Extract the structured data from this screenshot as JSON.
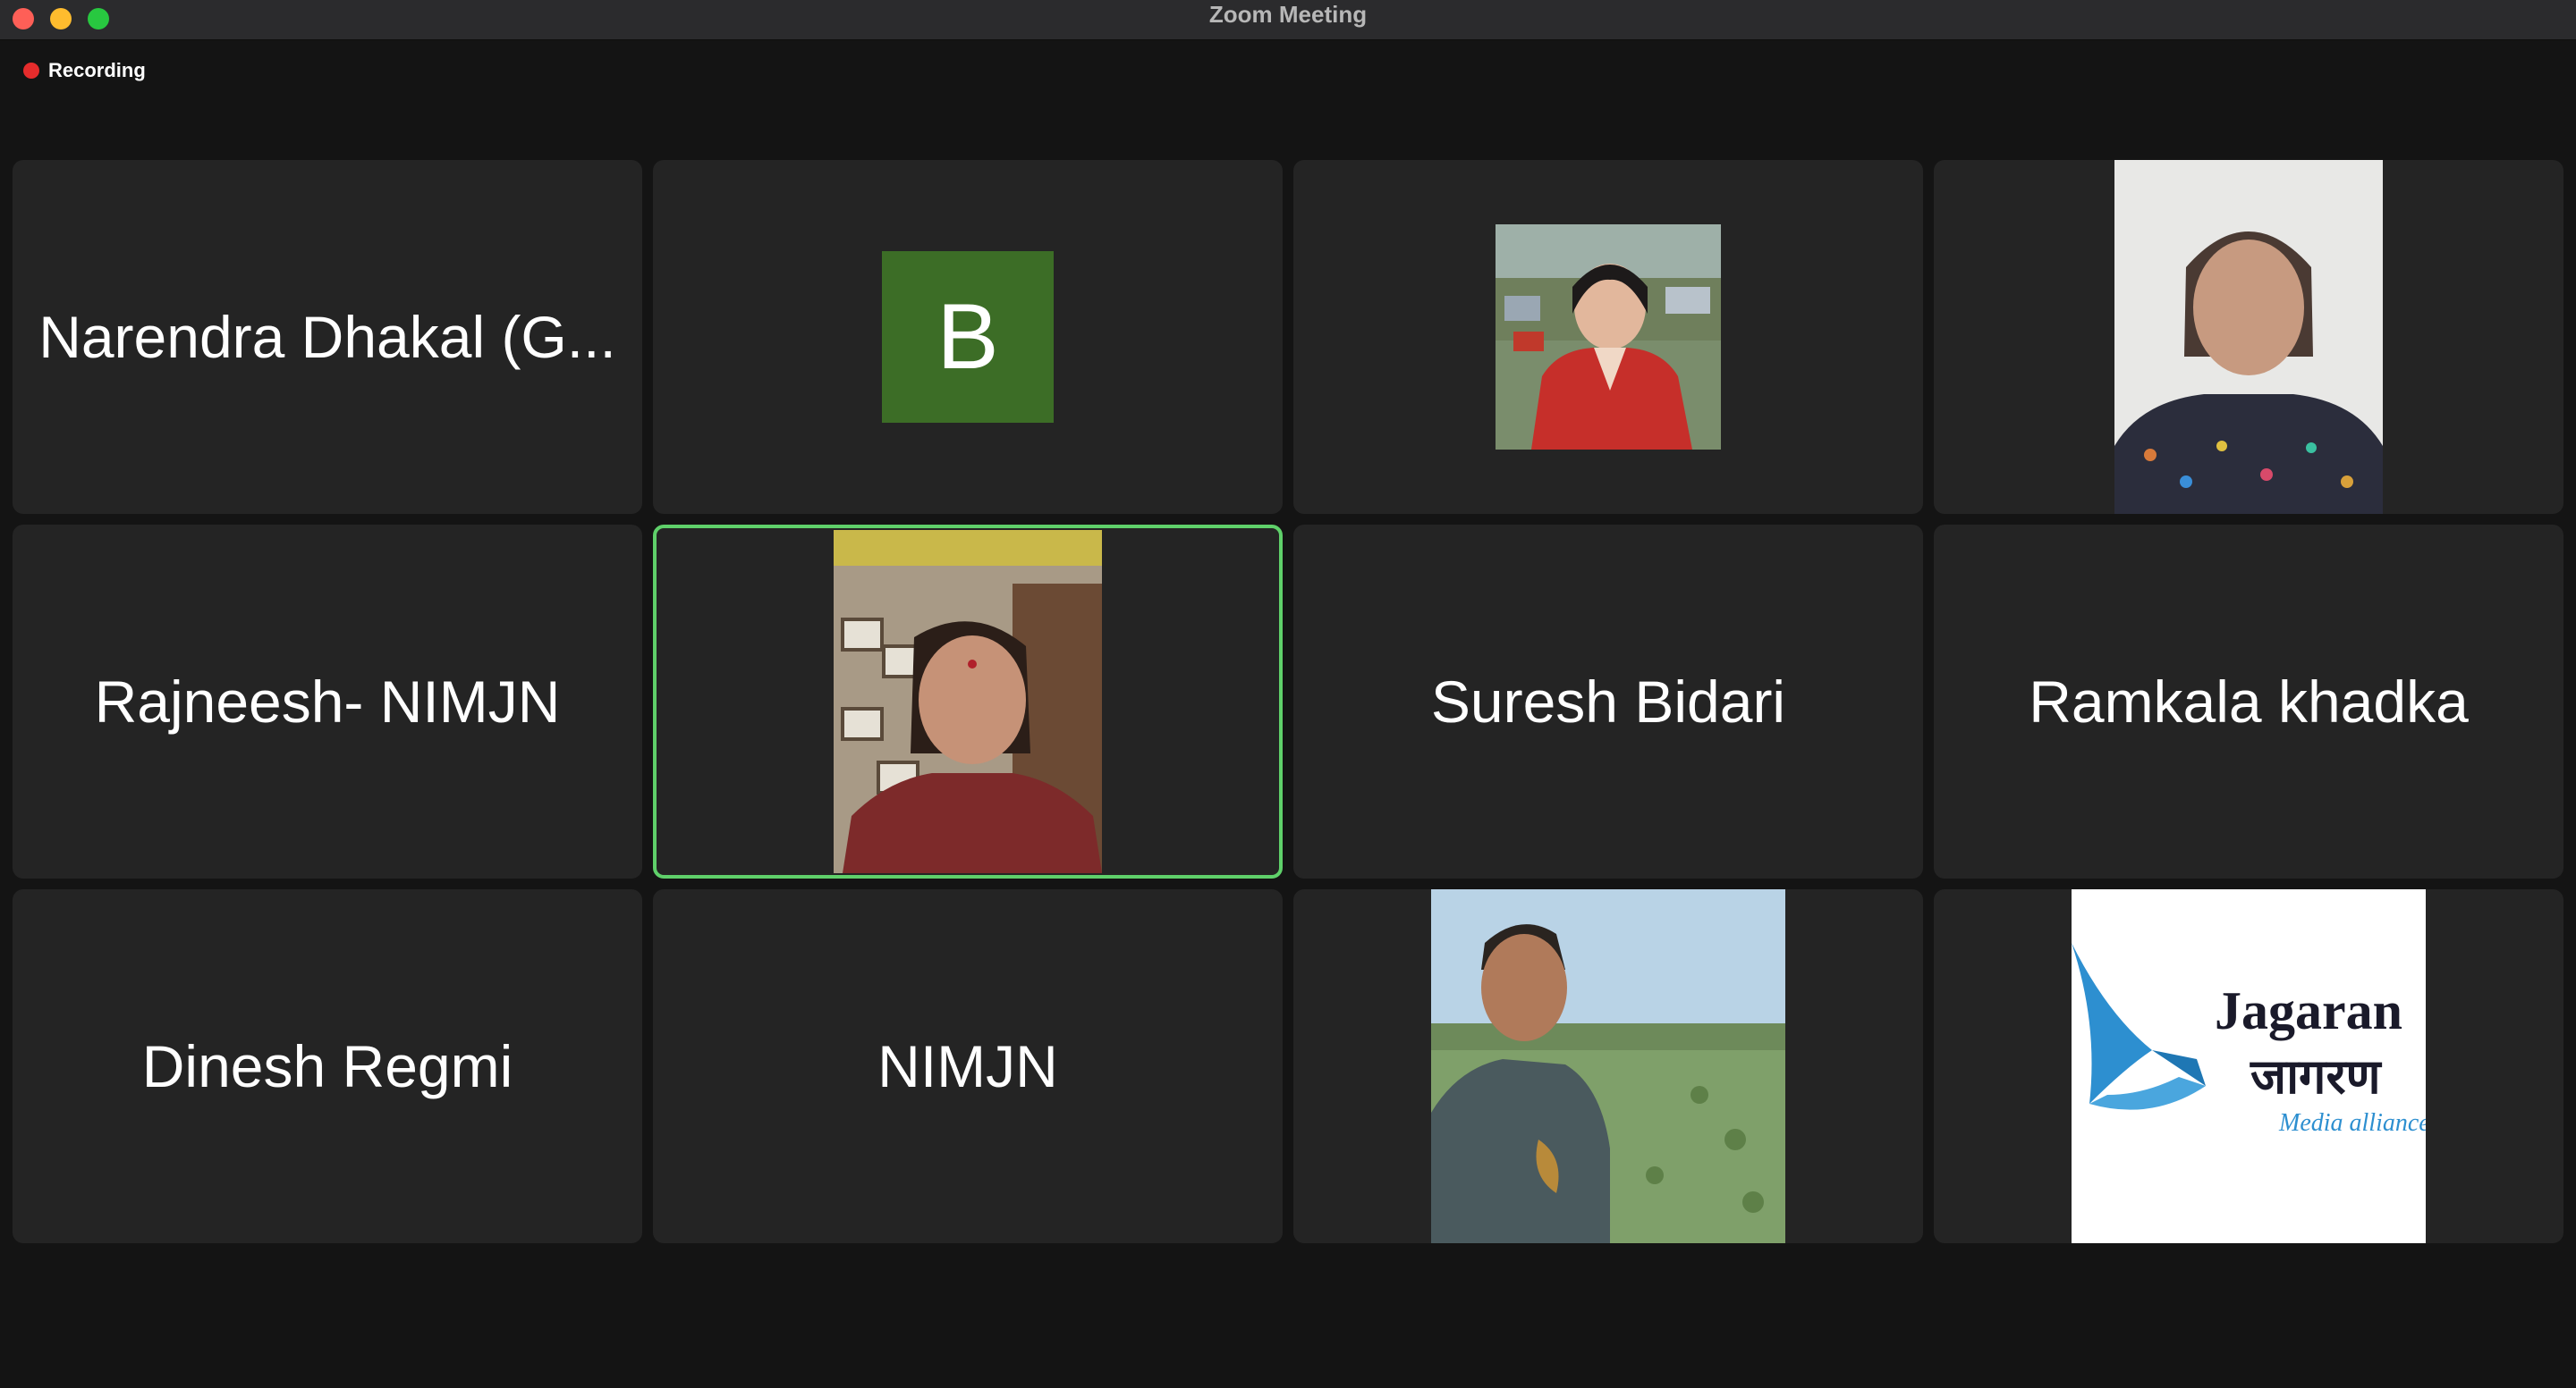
{
  "window": {
    "title": "Zoom Meeting"
  },
  "recording": {
    "label": "Recording"
  },
  "participants": [
    {
      "name": "Narendra Dhakal (G..."
    },
    {
      "initial": "B"
    },
    {
      "photo": "participant-photo-woman-red-jacket"
    },
    {
      "photo": "participant-photo-woman-floral-top"
    },
    {
      "name": "Rajneesh- NIMJN"
    },
    {
      "photo": "participant-photo-woman-office",
      "active": true
    },
    {
      "name": "Suresh Bidari"
    },
    {
      "name": "Ramkala khadka"
    },
    {
      "name": "Dinesh Regmi"
    },
    {
      "name": "NIMJN"
    },
    {
      "photo": "participant-photo-man-field"
    },
    {
      "logo": {
        "en": "Jagaran",
        "dev": "जागरण",
        "tag": "Media alliance"
      }
    }
  ],
  "colors": {
    "background": "#141414",
    "tile": "#242424",
    "active_border": "#5fd06a",
    "avatar_b": "#3c6d26",
    "recording_dot": "#e52c2c"
  }
}
